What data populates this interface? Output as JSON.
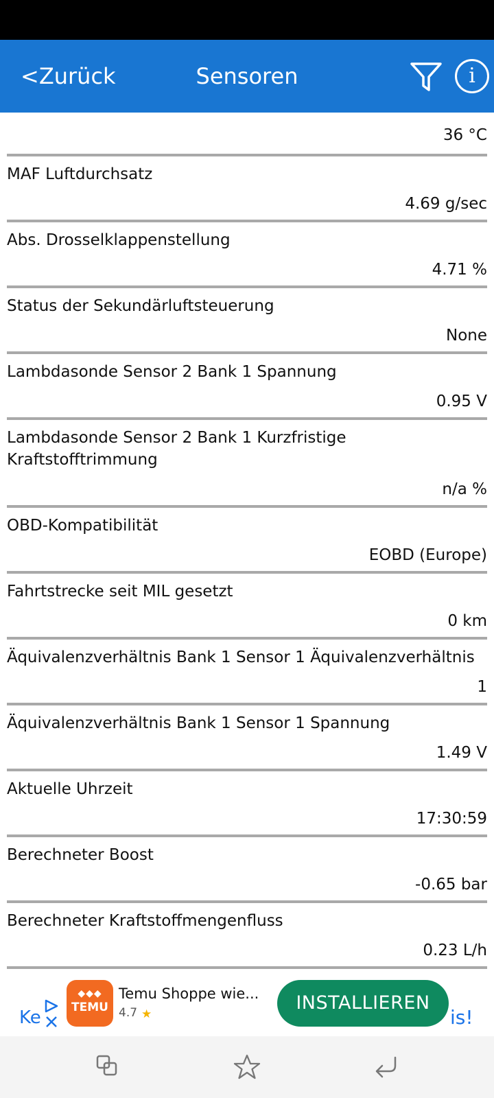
{
  "header": {
    "back_label": "<Zurück",
    "title": "Sensoren",
    "filter_icon": "filter-icon",
    "info_icon": "info-icon",
    "info_glyph": "i",
    "color": "#1976d2"
  },
  "sensors": [
    {
      "label": "",
      "value": "36 °C"
    },
    {
      "label": "MAF Luftdurchsatz",
      "value": "4.69 g/sec"
    },
    {
      "label": "Abs. Drosselklappenstellung",
      "value": "4.71 %"
    },
    {
      "label": "Status der Sekundärluftsteuerung",
      "value": "None"
    },
    {
      "label": "Lambdasonde Sensor 2 Bank 1 Spannung",
      "value": "0.95 V"
    },
    {
      "label": "Lambdasonde Sensor 2 Bank 1 Kurzfristige Kraftstofftrimmung",
      "value": "n/a %"
    },
    {
      "label": "OBD-Kompatibilität",
      "value": "EOBD (Europe)"
    },
    {
      "label": "Fahrtstrecke seit MIL gesetzt",
      "value": "0 km"
    },
    {
      "label": "Äquivalenzverhältnis Bank 1 Sensor 1 Äquivalenzverhältnis",
      "value": "1"
    },
    {
      "label": "Äquivalenzverhältnis Bank 1 Sensor 1 Spannung",
      "value": "1.49 V"
    },
    {
      "label": "Aktuelle Uhrzeit",
      "value": "17:30:59"
    },
    {
      "label": "Berechneter Boost",
      "value": "-0.65 bar"
    },
    {
      "label": "Berechneter Kraftstoffmengenfluss",
      "value": "0.23 L/h"
    }
  ],
  "ad": {
    "left_text": "Ke",
    "app_logo_text": "TEMU",
    "app_name": "Temu Shoppe wie...",
    "rating": "4.7",
    "star": "★",
    "install_label": "INSTALLIEREN",
    "tail_text": "is!",
    "install_color": "#0f8a5f",
    "app_color": "#f26a21"
  },
  "nav": {
    "buttons": [
      "recent-apps-icon",
      "star-icon",
      "back-arrow-icon"
    ]
  }
}
